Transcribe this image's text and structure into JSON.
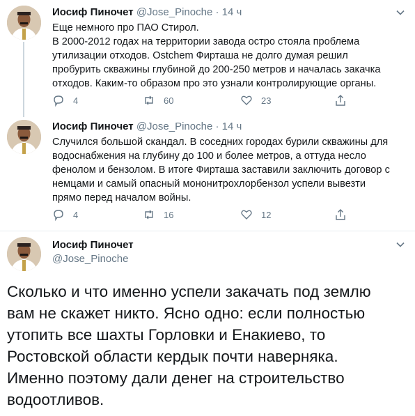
{
  "tweets": [
    {
      "author_name": "Иосиф Пиночет",
      "handle": "@Jose_Pinoche",
      "separator": "·",
      "time": "14 ч",
      "text_lines": [
        "Еще немного про ПАО Стирол.",
        "В 2000-2012 годах на территории завода остро стояла проблема",
        "утилизации отходов.  Ostchem Фирташа не долго думая решил",
        "пробурить скважины глубиной до 200-250 метров и началась закачка",
        "отходов. Каким-то образом про это узнали контролирующие органы."
      ],
      "replies": "4",
      "retweets": "60",
      "likes": "23"
    },
    {
      "author_name": "Иосиф Пиночет",
      "handle": "@Jose_Pinoche",
      "separator": "·",
      "time": "14 ч",
      "text_lines": [
        "Случился большой скандал. В соседних городах бурили скважины для",
        "водоснабжения на глубину до 100 и более метров, а оттуда несло",
        "фенолом и бензолом. В итоге Фирташа заставили заключить договор с",
        "немцами и самый опасный мононитрохлорбензол успели вывезти",
        "прямо перед началом войны."
      ],
      "replies": "4",
      "retweets": "16",
      "likes": "12"
    }
  ],
  "main_tweet": {
    "author_name": "Иосиф Пиночет",
    "handle": "@Jose_Pinoche",
    "text_lines": [
      "Сколько и что именно успели закачать под землю",
      "вам не скажет никто. Ясно одно: если полностью",
      "утопить все шахты Горловки и Енакиево, то",
      "Ростовской области кердык почти наверняка.",
      "Именно поэтому дали денег на строительство",
      "водоотливов."
    ]
  },
  "icons": {
    "reply": "reply-icon",
    "retweet": "retweet-icon",
    "like": "heart-icon",
    "share": "share-icon",
    "menu": "chevron-down-icon"
  },
  "colors": {
    "text": "#14171a",
    "secondary": "#657786",
    "thread_line": "#ccd6dd",
    "divider": "#e6ecf0"
  }
}
